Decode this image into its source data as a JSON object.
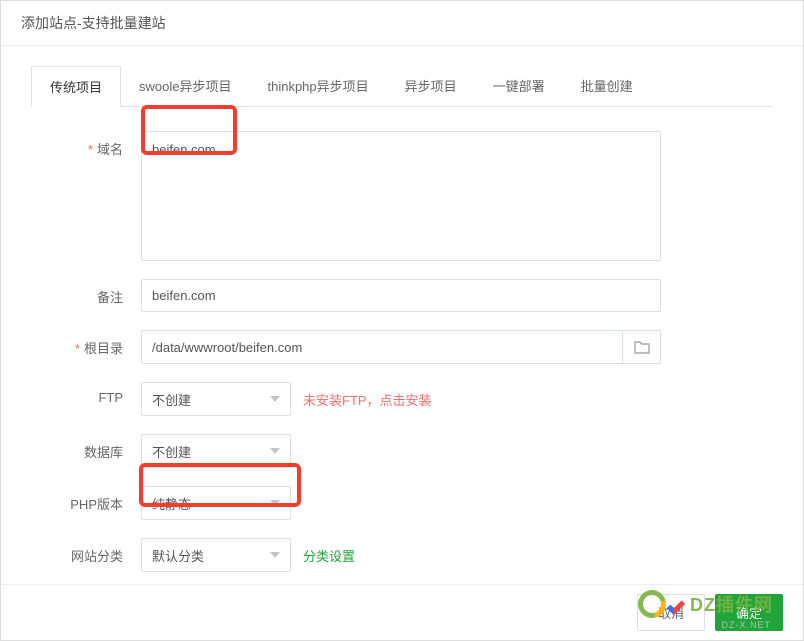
{
  "modal": {
    "title": "添加站点-支持批量建站"
  },
  "tabs": [
    {
      "label": "传统项目",
      "active": true
    },
    {
      "label": "swoole异步项目",
      "active": false
    },
    {
      "label": "thinkphp异步项目",
      "active": false
    },
    {
      "label": "异步项目",
      "active": false
    },
    {
      "label": "一键部署",
      "active": false
    },
    {
      "label": "批量创建",
      "active": false
    }
  ],
  "form": {
    "domain": {
      "label": "域名",
      "required": true,
      "value": "beifen.com"
    },
    "remark": {
      "label": "备注",
      "required": false,
      "value": "beifen.com"
    },
    "root": {
      "label": "根目录",
      "required": true,
      "value": "/data/wwwroot/beifen.com"
    },
    "ftp": {
      "label": "FTP",
      "required": false,
      "value": "不创建",
      "hint": "未安装FTP，点击安装"
    },
    "db": {
      "label": "数据库",
      "required": false,
      "value": "不创建"
    },
    "php": {
      "label": "PHP版本",
      "required": false,
      "value": "纯静态"
    },
    "category": {
      "label": "网站分类",
      "required": false,
      "value": "默认分类",
      "hint": "分类设置"
    }
  },
  "footer": {
    "cancel": "取消",
    "confirm": "确定"
  },
  "watermark": {
    "text": "DZ插件网",
    "sub": "DZ-X.NET"
  }
}
